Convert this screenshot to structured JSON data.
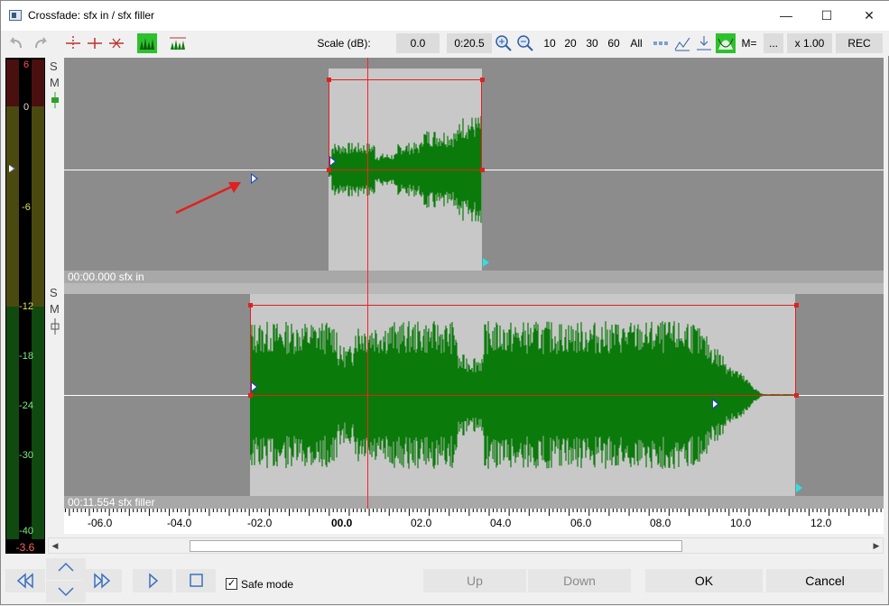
{
  "window": {
    "title": "Crossfade: sfx in / sfx filler",
    "controls": {
      "minimize": "—",
      "maximize": "☐",
      "close": "✕"
    }
  },
  "toolbar": {
    "scale_label": "Scale (dB):",
    "scale_value": "0.0",
    "view_length": "0:20.5",
    "zoom_presets": [
      "10",
      "20",
      "30",
      "60",
      "All"
    ],
    "m_label": "M=",
    "more_label": "...",
    "speed": "x 1.00",
    "rec_label": "REC"
  },
  "meter": {
    "labels": [
      "6",
      "0",
      "-6",
      "-12",
      "-18",
      "-24",
      "-30",
      "-40"
    ],
    "readout": "-3.6"
  },
  "tracks": {
    "ctrl_s": "S",
    "ctrl_m": "M",
    "top": {
      "label": "00:00.000 sfx in"
    },
    "bottom": {
      "label": "00:11.554 sfx filler"
    }
  },
  "ruler": {
    "labels": [
      "-06.0",
      "-04.0",
      "-02.0",
      "00.0",
      "02.0",
      "04.0",
      "06.0",
      "08.0",
      "10.0",
      "12.0"
    ]
  },
  "bottom": {
    "safe_mode_label": "Safe mode",
    "safe_mode_checked": true,
    "up_label": "Up",
    "down_label": "Down",
    "ok_label": "OK",
    "cancel_label": "Cancel"
  },
  "colors": {
    "waveform": "#0a7a0a",
    "cursor": "#ff2020",
    "selection": "#e02020",
    "accent_green": "#2ec12e"
  }
}
